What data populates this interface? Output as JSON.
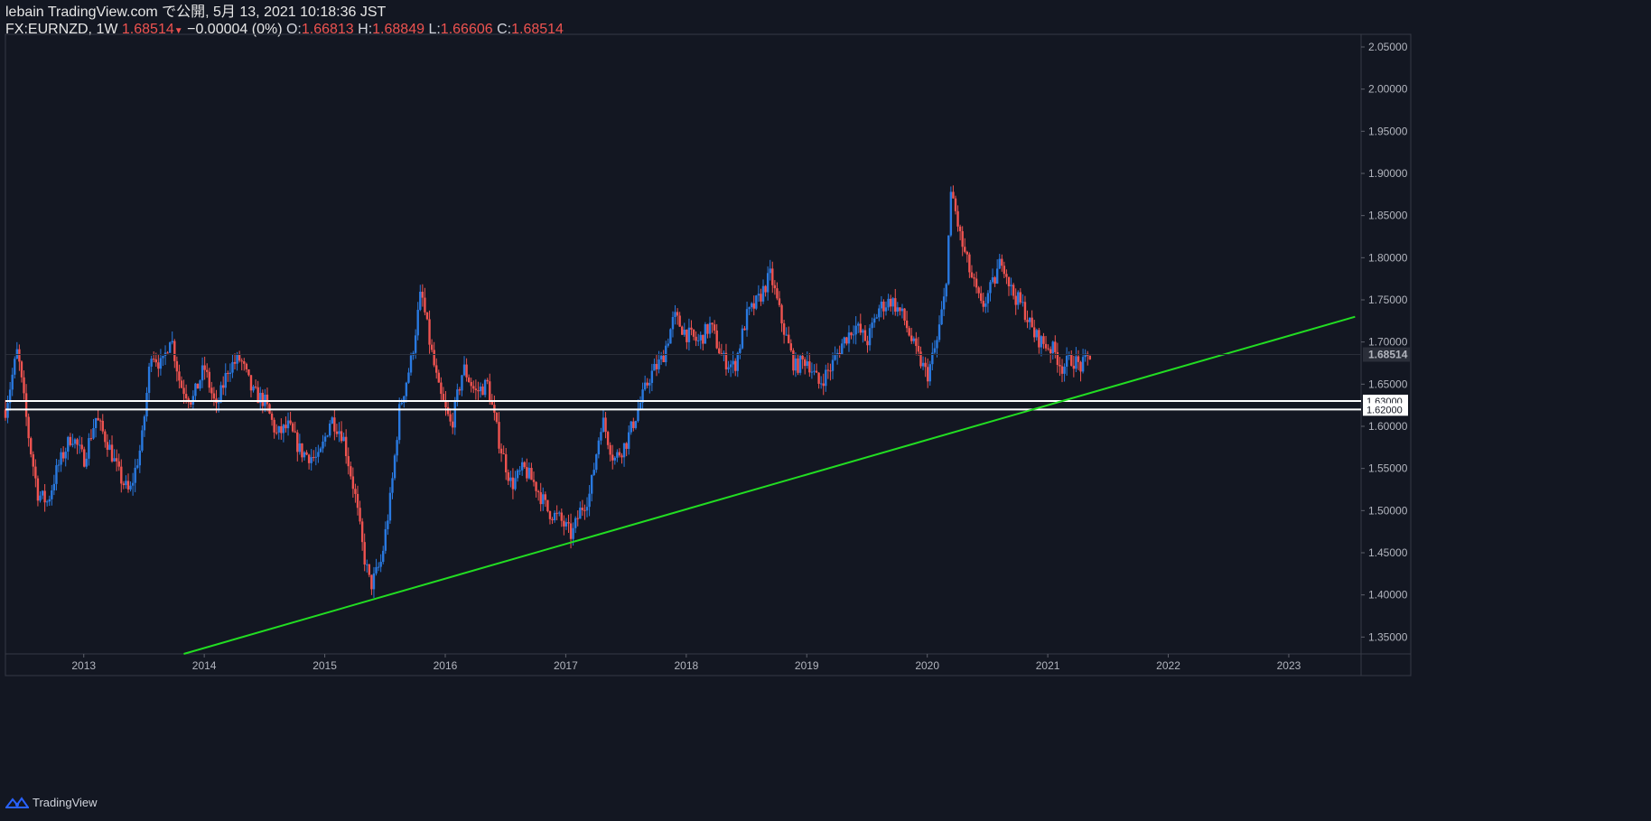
{
  "header": {
    "line1": "lebain TradingView.com で公開, 5月 13, 2021 10:18:36 JST",
    "symbol": "FX:EURNZD, 1W",
    "last": "1.68514",
    "change_arrow": "▼",
    "change": "−0.00004 (0%)",
    "o_label": "O:",
    "o_value": "1.66813",
    "h_label": "H:",
    "h_value": "1.68849",
    "l_label": "L:",
    "l_value": "1.66606",
    "c_label": "C:",
    "c_value": "1.68514"
  },
  "footer": {
    "brand": "TradingView",
    "icon": "tradingview-logo-icon"
  },
  "colors": {
    "background": "#131722",
    "up": "#2979e0",
    "down": "#ef5350",
    "trendline": "#22dd22",
    "level": "#ffffff",
    "axis_text": "#b2b5be"
  },
  "chart_data": {
    "type": "candlestick",
    "title": "FX:EURNZD, 1W",
    "xlabel": "",
    "ylabel": "",
    "x_ticks": [
      "2013",
      "2014",
      "2015",
      "2016",
      "2017",
      "2018",
      "2019",
      "2020",
      "2021",
      "2022",
      "2023"
    ],
    "y_ticks": [
      "2.05000",
      "2.00000",
      "1.95000",
      "1.90000",
      "1.85000",
      "1.80000",
      "1.75000",
      "1.70000",
      "1.65000",
      "1.60000",
      "1.55000",
      "1.50000",
      "1.45000",
      "1.40000",
      "1.35000"
    ],
    "ylim": [
      1.33,
      2.065
    ],
    "xlim": [
      2012.35,
      2023.6
    ],
    "last_price": "1.68514",
    "horizontal_levels": [
      {
        "value": 1.63,
        "label": "1.63000"
      },
      {
        "value": 1.62,
        "label": "1.62000"
      }
    ],
    "trendline": {
      "points": [
        [
          2013.83,
          1.33
        ],
        [
          2023.55,
          1.73
        ]
      ]
    },
    "close_series": [
      [
        "2012.35",
        1.62
      ],
      [
        "2012.45",
        1.69
      ],
      [
        "2012.55",
        1.58
      ],
      [
        "2012.62",
        1.52
      ],
      [
        "2012.7",
        1.51
      ],
      [
        "2012.78",
        1.55
      ],
      [
        "2012.9",
        1.59
      ],
      [
        "2013.0",
        1.56
      ],
      [
        "2013.1",
        1.61
      ],
      [
        "2013.2",
        1.58
      ],
      [
        "2013.3",
        1.54
      ],
      [
        "2013.38",
        1.52
      ],
      [
        "2013.48",
        1.58
      ],
      [
        "2013.56",
        1.69
      ],
      [
        "2013.65",
        1.67
      ],
      [
        "2013.72",
        1.71
      ],
      [
        "2013.8",
        1.65
      ],
      [
        "2013.9",
        1.63
      ],
      [
        "2014.0",
        1.67
      ],
      [
        "2014.1",
        1.62
      ],
      [
        "2014.2",
        1.67
      ],
      [
        "2014.3",
        1.68
      ],
      [
        "2014.4",
        1.64
      ],
      [
        "2014.5",
        1.63
      ],
      [
        "2014.6",
        1.59
      ],
      [
        "2014.7",
        1.6
      ],
      [
        "2014.8",
        1.57
      ],
      [
        "2014.95",
        1.56
      ],
      [
        "2015.05",
        1.61
      ],
      [
        "2015.15",
        1.59
      ],
      [
        "2015.25",
        1.52
      ],
      [
        "2015.32",
        1.45
      ],
      [
        "2015.38",
        1.41
      ],
      [
        "2015.47",
        1.44
      ],
      [
        "2015.55",
        1.52
      ],
      [
        "2015.62",
        1.62
      ],
      [
        "2015.72",
        1.68
      ],
      [
        "2015.8",
        1.76
      ],
      [
        "2015.87",
        1.7
      ],
      [
        "2015.95",
        1.64
      ],
      [
        "2016.05",
        1.6
      ],
      [
        "2016.15",
        1.67
      ],
      [
        "2016.25",
        1.64
      ],
      [
        "2016.35",
        1.65
      ],
      [
        "2016.45",
        1.58
      ],
      [
        "2016.55",
        1.53
      ],
      [
        "2016.65",
        1.55
      ],
      [
        "2016.75",
        1.53
      ],
      [
        "2016.85",
        1.5
      ],
      [
        "2016.95",
        1.49
      ],
      [
        "2017.05",
        1.47
      ],
      [
        "2017.12",
        1.5
      ],
      [
        "2017.2",
        1.52
      ],
      [
        "2017.3",
        1.61
      ],
      [
        "2017.4",
        1.56
      ],
      [
        "2017.5",
        1.58
      ],
      [
        "2017.6",
        1.62
      ],
      [
        "2017.7",
        1.66
      ],
      [
        "2017.8",
        1.68
      ],
      [
        "2017.9",
        1.73
      ],
      [
        "2018.0",
        1.71
      ],
      [
        "2018.1",
        1.7
      ],
      [
        "2018.2",
        1.72
      ],
      [
        "2018.3",
        1.68
      ],
      [
        "2018.4",
        1.67
      ],
      [
        "2018.5",
        1.73
      ],
      [
        "2018.6",
        1.75
      ],
      [
        "2018.7",
        1.78
      ],
      [
        "2018.8",
        1.72
      ],
      [
        "2018.9",
        1.67
      ],
      [
        "2019.0",
        1.68
      ],
      [
        "2019.1",
        1.65
      ],
      [
        "2019.2",
        1.67
      ],
      [
        "2019.3",
        1.7
      ],
      [
        "2019.4",
        1.72
      ],
      [
        "2019.5",
        1.7
      ],
      [
        "2019.6",
        1.74
      ],
      [
        "2019.7",
        1.75
      ],
      [
        "2019.8",
        1.73
      ],
      [
        "2019.9",
        1.69
      ],
      [
        "2020.0",
        1.66
      ],
      [
        "2020.08",
        1.7
      ],
      [
        "2020.15",
        1.76
      ],
      [
        "2020.2",
        1.88
      ],
      [
        "2020.28",
        1.82
      ],
      [
        "2020.36",
        1.78
      ],
      [
        "2020.45",
        1.74
      ],
      [
        "2020.55",
        1.77
      ],
      [
        "2020.62",
        1.8
      ],
      [
        "2020.7",
        1.76
      ],
      [
        "2020.8",
        1.74
      ],
      [
        "2020.88",
        1.71
      ],
      [
        "2020.95",
        1.7
      ],
      [
        "2021.05",
        1.69
      ],
      [
        "2021.12",
        1.67
      ],
      [
        "2021.2",
        1.68
      ],
      [
        "2021.28",
        1.67
      ],
      [
        "2021.35",
        1.685
      ]
    ]
  }
}
